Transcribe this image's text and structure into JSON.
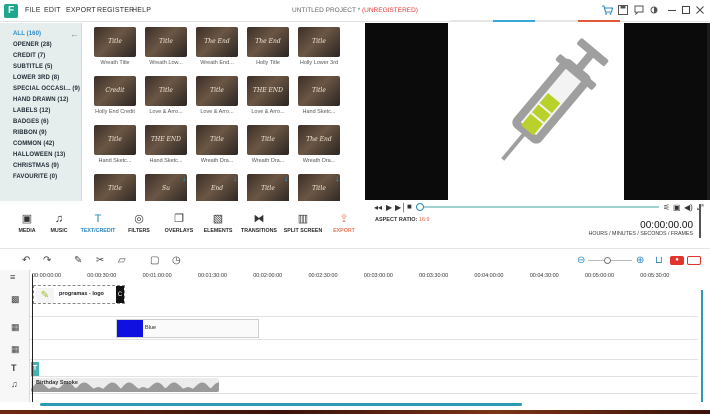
{
  "titlebar": {
    "logo": "F",
    "menu": [
      "FILE",
      "EDIT",
      "EXPORT",
      "REGISTER",
      "HELP"
    ],
    "title": "UNTITLED PROJECT * ",
    "title_status": "(UNREGISTERED)",
    "icons": [
      "cart-icon",
      "save-icon",
      "chat-icon",
      "brightness-icon",
      "minimize-icon",
      "maximize-icon",
      "close-icon"
    ],
    "strip_colors": [
      "#e6e6e6",
      "#3aa7d8",
      "#e6e6e6",
      "#e05a3a"
    ]
  },
  "sidebar": {
    "categories": [
      {
        "label": "ALL (160)",
        "active": true
      },
      {
        "label": "OPENER (28)"
      },
      {
        "label": "CREDIT (7)"
      },
      {
        "label": "SUBTITLE (5)"
      },
      {
        "label": "LOWER 3RD (8)"
      },
      {
        "label": "SPECIAL OCCASI... (9)"
      },
      {
        "label": "HAND DRAWN (12)"
      },
      {
        "label": "LABELS (12)"
      },
      {
        "label": "BADGES (6)"
      },
      {
        "label": "RIBBON (9)"
      },
      {
        "label": "COMMON (42)"
      },
      {
        "label": "HALLOWEEN (13)"
      },
      {
        "label": "CHRISTMAS (9)"
      },
      {
        "label": "FAVOURITE (0)"
      }
    ]
  },
  "thumbnails": [
    {
      "label": "Wreath Title",
      "overlay": "Title"
    },
    {
      "label": "Wreath Low...",
      "overlay": "Title"
    },
    {
      "label": "Wreath End...",
      "overlay": "The End"
    },
    {
      "label": "Holly Title",
      "overlay": "The End"
    },
    {
      "label": "Holly Lower 3rd",
      "overlay": "Title"
    },
    {
      "label": "Holly End Credit",
      "overlay": "Credit"
    },
    {
      "label": "Love & Arro...",
      "overlay": "Title"
    },
    {
      "label": "Love & Arro...",
      "overlay": "Title"
    },
    {
      "label": "Love & Arro...",
      "overlay": "THE END"
    },
    {
      "label": "Hand Sketc...",
      "overlay": "Title"
    },
    {
      "label": "Hand Sketc...",
      "overlay": "Title"
    },
    {
      "label": "Hand Sketc...",
      "overlay": "THE END"
    },
    {
      "label": "Wreath Dra...",
      "overlay": "Title"
    },
    {
      "label": "Wreath Dra...",
      "overlay": "Title"
    },
    {
      "label": "Wreath Dra...",
      "overlay": "The End"
    },
    {
      "label": "",
      "overlay": "Title"
    },
    {
      "label": "",
      "overlay": "Su"
    },
    {
      "label": "",
      "overlay": "End"
    },
    {
      "label": "",
      "overlay": "Title"
    },
    {
      "label": "",
      "overlay": "Title"
    }
  ],
  "toolbar": {
    "tools": [
      {
        "label": "MEDIA",
        "icon": "media-icon"
      },
      {
        "label": "MUSIC",
        "icon": "music-icon"
      },
      {
        "label": "TEXT/CREDIT",
        "icon": "text-icon",
        "active": true
      },
      {
        "label": "FILTERS",
        "icon": "filters-icon"
      },
      {
        "label": "OVERLAYS",
        "icon": "overlays-icon"
      },
      {
        "label": "ELEMENTS",
        "icon": "elements-icon"
      },
      {
        "label": "TRANSITIONS",
        "icon": "transitions-icon"
      },
      {
        "label": "SPLIT SCREEN",
        "icon": "split-screen-icon"
      },
      {
        "label": "EXPORT",
        "icon": "export-icon"
      }
    ],
    "aspect_label": "ASPECT RATIO: ",
    "aspect_value": "16:9",
    "timecode": "00:00:00.00",
    "timecode_label": "HOURS / MINUTES / SECONDS / FRAMES"
  },
  "timeline": {
    "ticks": [
      "00:00:00:00",
      "00:00:30:00",
      "00:01:00:00",
      "00:01:30:00",
      "00:02:00:00",
      "00:02:30:00",
      "00:03:00:00",
      "00:03:30:00",
      "00:04:00:00",
      "00:04:30:00",
      "00:05:00:00",
      "00:05:30:00"
    ],
    "clips": {
      "logo": "programas - logo",
      "logo_end": "C",
      "blue": "Blue",
      "text": "T",
      "audio": "Birthday Smoke"
    }
  }
}
